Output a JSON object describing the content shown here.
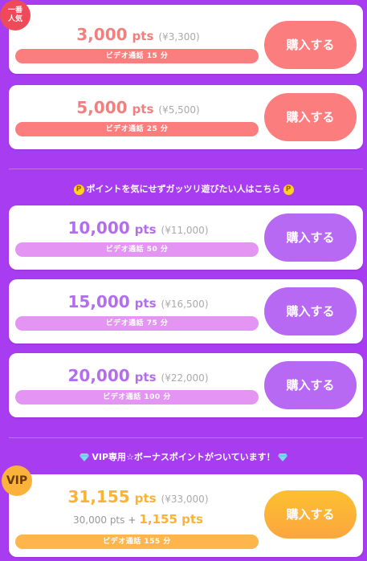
{
  "plans_top": [
    {
      "points": "3,000",
      "unit": "pts",
      "yen": "(¥3,300)",
      "bar": "ビデオ通話 15 分",
      "buy": "購入する",
      "theme": "red"
    },
    {
      "points": "5,000",
      "unit": "pts",
      "yen": "(¥5,500)",
      "bar": "ビデオ通話 25 分",
      "buy": "購入する",
      "theme": "red"
    }
  ],
  "badge_popular": {
    "line1": "一番",
    "line2": "人気"
  },
  "section_mid": {
    "text": "ポイントを気にせずガッツリ遊びたい人はこちら",
    "icon_left": "coin-icon",
    "icon_right": "coin-icon",
    "coin_glyph": "P"
  },
  "plans_mid": [
    {
      "points": "10,000",
      "unit": "pts",
      "yen": "(¥11,000)",
      "bar": "ビデオ通話 50 分",
      "buy": "購入する",
      "theme": "purple"
    },
    {
      "points": "15,000",
      "unit": "pts",
      "yen": "(¥16,500)",
      "bar": "ビデオ通話 75 分",
      "buy": "購入する",
      "theme": "purple"
    },
    {
      "points": "20,000",
      "unit": "pts",
      "yen": "(¥22,000)",
      "bar": "ビデオ通話 100 分",
      "buy": "購入する",
      "theme": "purple"
    }
  ],
  "section_vip": {
    "text": "VIP専用☆ボーナスポイントがついています！",
    "icon_left": "diamond-icon",
    "icon_right": "diamond-icon"
  },
  "vip_plan": {
    "badge": "VIP",
    "points": "31,155",
    "unit": "pts",
    "yen": "(¥33,000)",
    "base": "30,000 pts",
    "plus": "+",
    "bonus": "1,155 pts",
    "bar": "ビデオ通話 155 分",
    "buy": "購入する",
    "theme": "gold"
  },
  "colors": {
    "background": "#a83cf0",
    "red": "#fb7d7d",
    "purple": "#b769f3",
    "gold": "#fdb54c"
  }
}
